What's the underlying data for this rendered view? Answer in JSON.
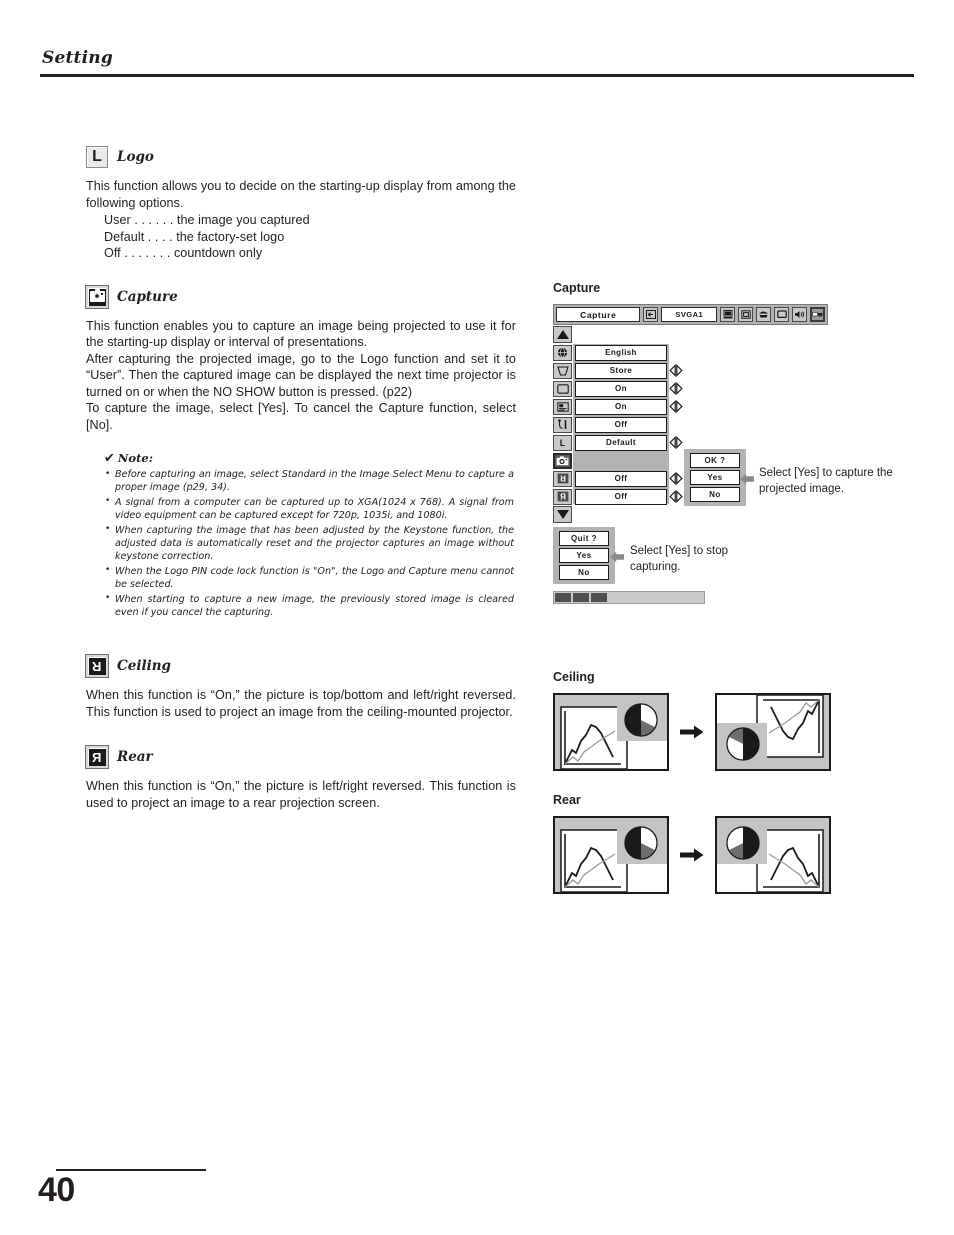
{
  "header": {
    "title": "Setting"
  },
  "page": {
    "number": "40"
  },
  "sections": {
    "logo": {
      "icon": "logo-L-icon",
      "icon_letter": "L",
      "title": "Logo",
      "paragraph": "This function allows you to decide on the starting-up display from among the following options.",
      "options": [
        "User  . . . . . .  the image you captured",
        "Default  . . . .  the factory-set logo",
        "Off  . . . . . . .  countdown only"
      ]
    },
    "capture": {
      "icon": "camera-icon",
      "title": "Capture",
      "paragraphs": [
        "This function enables you to capture an image being projected to use it for the starting-up display or interval of presentations.",
        "After capturing the projected image, go to the Logo function and set it to “User”. Then the captured image can be displayed the next time projector is turned on or when the NO SHOW button is pressed. (p22)",
        "To capture the image, select [Yes]. To cancel the Capture function, select [No]."
      ],
      "note": {
        "check": "✔",
        "label": "Note:",
        "items": [
          "Before capturing an image, select Standard in the Image Select Menu to capture a proper image (p29, 34).",
          "A signal from a computer can be captured up to XGA(1024 x 768). A signal from video equipment can be captured except for 720p, 1035i, and 1080i.",
          "When capturing the image that has been adjusted by the Keystone function, the adjusted data is automatically reset and the projector captures an image without keystone correction.",
          "When the Logo PIN code lock function is \"On\", the Logo and Capture menu cannot be selected.",
          "When starting to capture a new image, the previously stored image is cleared even if you cancel the capturing."
        ]
      }
    },
    "ceiling": {
      "icon": "ceiling-flip-icon",
      "icon_letter": "R",
      "title": "Ceiling",
      "paragraph": "When this function is “On,” the picture is top/bottom and left/right reversed. This function is used to project an image from the ceiling-mounted projector."
    },
    "rear": {
      "icon": "rear-flip-icon",
      "icon_letter": "R",
      "title": "Rear",
      "paragraph": "When this function is “On,” the picture is left/right reversed. This function is used to project an image to a rear projection screen."
    }
  },
  "figures": {
    "capture_caption": "Capture",
    "ceiling_caption": "Ceiling",
    "rear_caption": "Rear"
  },
  "osd": {
    "title": "Capture",
    "source": "SVGA1",
    "topbar_icons": [
      "input-icon",
      "computer-icon",
      "screen-icon",
      "color-icon",
      "image-icon",
      "sound-icon",
      "setting-icon"
    ],
    "scroll_up": "▲",
    "scroll_down": "▼",
    "rows": [
      {
        "icon": "language-globe-icon",
        "value": "English",
        "adjustable": false
      },
      {
        "icon": "keystone-icon",
        "value": "Store",
        "adjustable": true
      },
      {
        "icon": "blue-back-icon",
        "value": "On",
        "adjustable": true
      },
      {
        "icon": "display-icon",
        "value": "On",
        "adjustable": true
      },
      {
        "icon": "menu-position-icon",
        "value": "Off",
        "adjustable": false
      },
      {
        "icon": "logo-L-icon",
        "value": "Default",
        "adjustable": true
      },
      {
        "icon": "camera-icon",
        "value": "",
        "adjustable": false,
        "selected": true
      },
      {
        "icon": "ceiling-icon",
        "value": "Off",
        "adjustable": true
      },
      {
        "icon": "rear-icon",
        "value": "Off",
        "adjustable": true
      }
    ],
    "ok_dialog": {
      "prompt": "OK ?",
      "yes": "Yes",
      "no": "No"
    },
    "ok_callout": "Select [Yes] to capture the projected image.",
    "quit_dialog": {
      "prompt": "Quit ?",
      "yes": "Yes",
      "no": "No"
    },
    "quit_callout": "Select [Yes] to stop capturing.",
    "progress_segments": 3
  },
  "colors": {
    "text": "#231f20",
    "osd_gray": "#b3b3b3",
    "osd_btn": "#c9c9c9",
    "fig_gray": "#c4c4c4"
  }
}
